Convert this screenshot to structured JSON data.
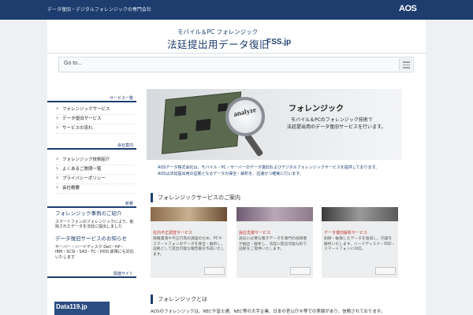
{
  "topbar": {
    "tagline": "データ復旧・デジタルフォレンジックの専門会社",
    "logo": "AOS"
  },
  "header": {
    "subtitle": "モバイル＆PC フォレンジック",
    "title": "法廷提出用データ復旧",
    "domain": "FSS.jp"
  },
  "nav": {
    "goto": "Go to..."
  },
  "sidebar": {
    "section1": {
      "heading": "サービス一覧",
      "items": [
        "フォレンジックサービス",
        "データ復旧サービス",
        "サービスの流れ"
      ]
    },
    "section2": {
      "heading": "会社案内",
      "items": [
        "フォレンジック技術紹介",
        "よくあるご質問一覧",
        "プライバシーポリシー",
        "会社概要"
      ]
    },
    "section3": {
      "heading": "新着",
      "news": [
        {
          "title": "フォレンジック事例のご紹介",
          "text": "スマートフォンのフォレンジックにより、削除されたデータを法廷に提出しました"
        },
        {
          "title": "データ復旧サービスのお知らせ",
          "text": "サーバー・ハードディスク Dell・HP・IBM・SCSI・SAS・FC・HDD 故障にも対応いたします"
        }
      ]
    },
    "section4": {
      "heading": "関連サイト",
      "banner": "Data119.jp"
    }
  },
  "hero": {
    "lens_text": "analyze",
    "title": "フォレンジック",
    "line1": "モバイル＆PCのフォレンジック技術で",
    "line2": "法廷提出用のデータ復旧サービスを行います。"
  },
  "intro": {
    "line1": "AOSデータ株式会社は、モバイル・PC・サーバーのデータ復旧およびデジタルフォレンジックサービスを提供しております。",
    "line2": "AOSは法廷提出用の証拠となるデータの保全・解析を、迅速かつ確実に行います。"
  },
  "services": {
    "heading": "フォレンジックサービスのご案内",
    "cards": [
      {
        "title": "社内不正調査サービス",
        "desc": "情報漏洩や不正行為の調査のため、PCやスマートフォンのデータを保全・解析し、証拠として提出可能な報告書を作成いたします。"
      },
      {
        "title": "訴訟支援サービス",
        "desc": "訴訟に必要な電子データを専門の技術者が抽出・解析し、法廷に提出可能な形で証拠をご提供いたします。"
      },
      {
        "title": "データ復旧解析サービス",
        "desc": "削除・破損したデータを復旧し、内容を解析いたします。ハードディスク・SSD・スマートフォンに対応。"
      }
    ]
  },
  "forensics": {
    "heading": "フォレンジックとは",
    "text": "AOSのフォレンジックは、NECや富士通、NEC等の大手企業、日本の官公庁®等での実績があり、信頼されております。"
  },
  "colors": {
    "brand": "#1c3d6e",
    "card_title": "#c0392b"
  }
}
